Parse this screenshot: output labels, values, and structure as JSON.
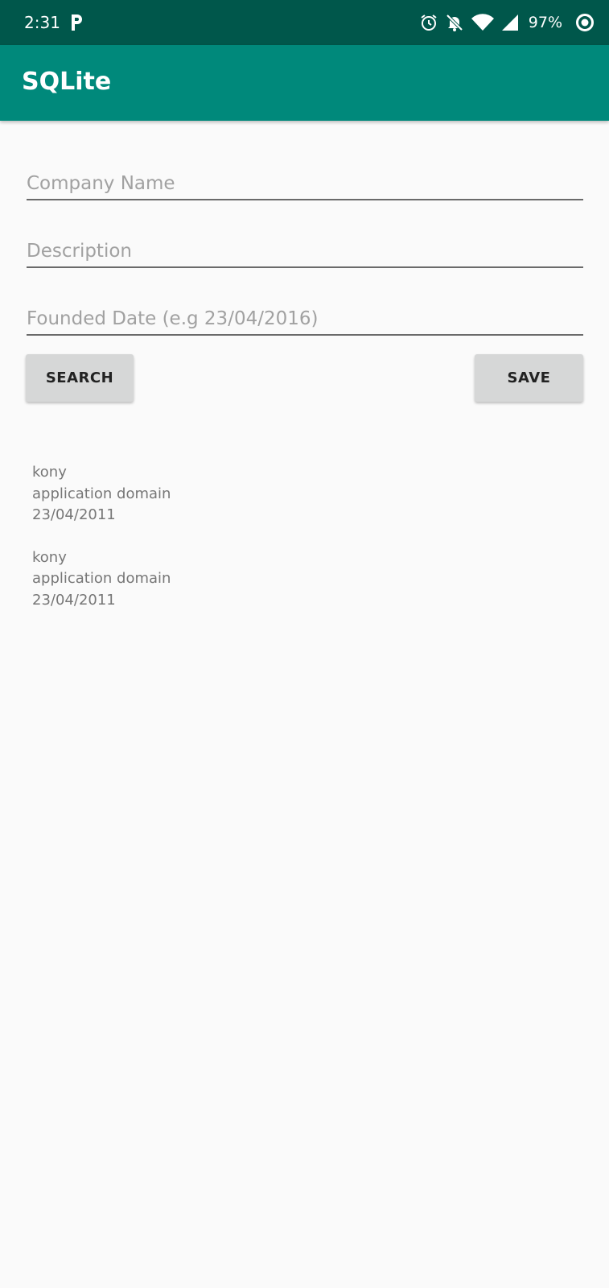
{
  "status_bar": {
    "time": "2:31",
    "battery": "97%",
    "icons": [
      "parking-icon",
      "alarm-icon",
      "notifications-off-icon",
      "wifi-icon",
      "signal-icon",
      "circle-target-icon"
    ]
  },
  "app_bar": {
    "title": "SQLite"
  },
  "form": {
    "company_name_placeholder": "Company Name",
    "description_placeholder": "Description",
    "founded_date_placeholder": "Founded Date (e.g 23/04/2016)",
    "search_label": "SEARCH",
    "save_label": "SAVE"
  },
  "results": [
    {
      "name": "kony",
      "description": "application domain",
      "date": "23/04/2011"
    },
    {
      "name": "kony",
      "description": "application domain",
      "date": "23/04/2011"
    }
  ],
  "colors": {
    "status_bar": "#00574b",
    "app_bar": "#00897b",
    "background": "#fafafa",
    "button": "#d6d7d7"
  }
}
